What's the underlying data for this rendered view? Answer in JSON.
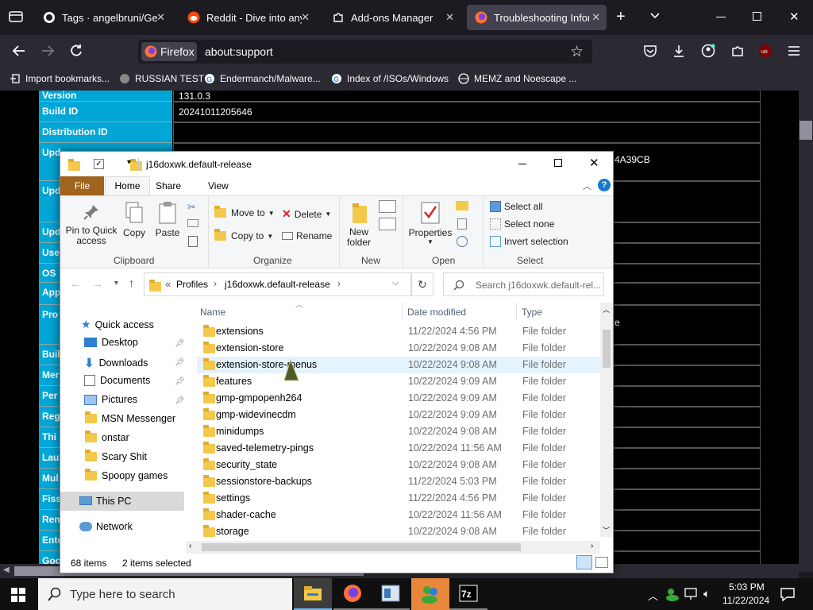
{
  "browser": {
    "tabs": [
      {
        "label": "Tags · angelbruni/Geck",
        "icon": "github-icon"
      },
      {
        "label": "Reddit - Dive into anyth",
        "icon": "reddit-icon"
      },
      {
        "label": "Add-ons Manager",
        "icon": "puzzle-icon"
      },
      {
        "label": "Troubleshooting Inform",
        "icon": "firefox-icon"
      }
    ],
    "url_identity": "Firefox",
    "url": "about:support",
    "bookmarks": [
      "Import bookmarks...",
      "RUSSIAN TEST",
      "Endermanch/Malware...",
      "Index of /ISOs/Windows",
      "MEMZ and Noescape ..."
    ]
  },
  "support_table": {
    "rows": [
      {
        "key": "Version",
        "value": "131.0.3"
      },
      {
        "key": "Build ID",
        "value": "20241011205646"
      },
      {
        "key": "Distribution ID",
        "value": ""
      },
      {
        "key": "Upd",
        "value": ""
      },
      {
        "key": "Upd",
        "value": ""
      },
      {
        "key": "Upd",
        "value": ""
      },
      {
        "key": "Use",
        "value": ""
      },
      {
        "key": "OS",
        "value": ""
      },
      {
        "key": "App",
        "value": ""
      },
      {
        "key": "Pro",
        "value": ""
      },
      {
        "key": "Buil",
        "value": ""
      },
      {
        "key": "Mer",
        "value": ""
      },
      {
        "key": "Per",
        "value": ""
      },
      {
        "key": "Reg",
        "value": ""
      },
      {
        "key": "Thi",
        "value": ""
      },
      {
        "key": "Lau",
        "value": ""
      },
      {
        "key": "Mul",
        "value": ""
      },
      {
        "key": "Fiss",
        "value": ""
      },
      {
        "key": "Ren",
        "value": ""
      },
      {
        "key": "Ente",
        "value": ""
      },
      {
        "key": "Goo",
        "value": ""
      }
    ],
    "peek_value_1": "4A39CB",
    "peek_value_2": "e"
  },
  "explorer": {
    "title": "j16doxwk.default-release",
    "ribbon_tabs": [
      "File",
      "Home",
      "Share",
      "View"
    ],
    "clipboard": {
      "pin": "Pin to Quick access",
      "copy": "Copy",
      "paste": "Paste",
      "label": "Clipboard"
    },
    "organize": {
      "move_to": "Move to",
      "copy_to": "Copy to",
      "delete": "Delete",
      "rename": "Rename",
      "label": "Organize"
    },
    "new": {
      "new_folder": "New folder",
      "label": "New"
    },
    "open": {
      "properties": "Properties",
      "label": "Open"
    },
    "select": {
      "select_all": "Select all",
      "select_none": "Select none",
      "invert": "Invert selection",
      "label": "Select"
    },
    "breadcrumb": [
      "Profiles",
      "j16doxwk.default-release"
    ],
    "breadcrumb_prefix": "«",
    "search_placeholder": "Search j16doxwk.default-rel...",
    "nav_pane": {
      "quick_access": "Quick access",
      "pinned": [
        "Desktop",
        "Downloads",
        "Documents",
        "Pictures"
      ],
      "folders": [
        "MSN Messenger",
        "onstar",
        "Scary Shit",
        "Spoopy games"
      ],
      "this_pc": "This PC",
      "network": "Network"
    },
    "columns": {
      "name": "Name",
      "date": "Date modified",
      "type": "Type"
    },
    "files": [
      {
        "name": "extensions",
        "date": "11/22/2024 4:56 PM",
        "type": "File folder"
      },
      {
        "name": "extension-store",
        "date": "10/22/2024 9:08 AM",
        "type": "File folder"
      },
      {
        "name": "extension-store-menus",
        "date": "10/22/2024 9:08 AM",
        "type": "File folder"
      },
      {
        "name": "features",
        "date": "10/22/2024 9:09 AM",
        "type": "File folder"
      },
      {
        "name": "gmp-gmpopenh264",
        "date": "10/22/2024 9:09 AM",
        "type": "File folder"
      },
      {
        "name": "gmp-widevinecdm",
        "date": "10/22/2024 9:09 AM",
        "type": "File folder"
      },
      {
        "name": "minidumps",
        "date": "10/22/2024 9:08 AM",
        "type": "File folder"
      },
      {
        "name": "saved-telemetry-pings",
        "date": "10/22/2024 11:56 AM",
        "type": "File folder"
      },
      {
        "name": "security_state",
        "date": "10/22/2024 9:08 AM",
        "type": "File folder"
      },
      {
        "name": "sessionstore-backups",
        "date": "11/22/2024 5:03 PM",
        "type": "File folder"
      },
      {
        "name": "settings",
        "date": "11/22/2024 4:56 PM",
        "type": "File folder"
      },
      {
        "name": "shader-cache",
        "date": "10/22/2024 11:56 AM",
        "type": "File folder"
      },
      {
        "name": "storage",
        "date": "10/22/2024 9:08 AM",
        "type": "File folder"
      }
    ],
    "status_items": "68 items",
    "status_selected": "2 items selected"
  },
  "taskbar": {
    "search_placeholder": "Type here to search",
    "time": "5:03 PM",
    "date": "11/22/2024"
  },
  "colors": {
    "support_key_bg": "#00a6d6",
    "file_tab": "#a0641e",
    "taskbar_active": "#e8873a"
  }
}
